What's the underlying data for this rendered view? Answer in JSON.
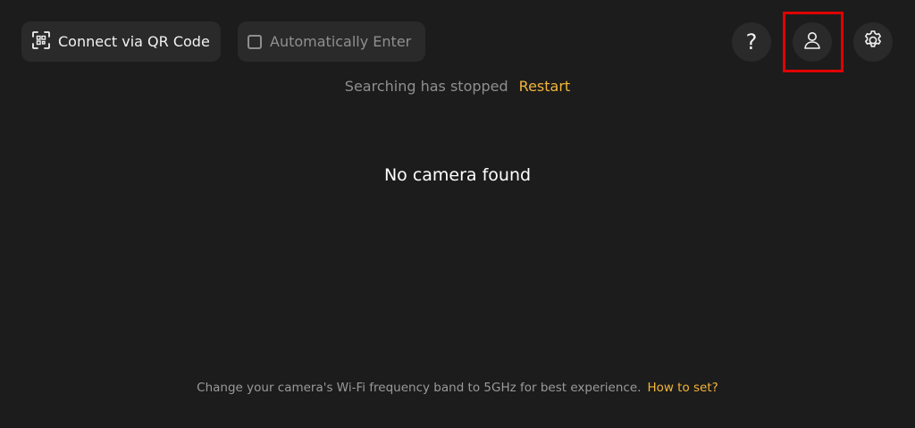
{
  "top_bar": {
    "qr_button_label": "Connect via QR Code",
    "auto_enter_label": "Automatically Enter",
    "auto_enter_checked": false,
    "help_glyph": "?",
    "icons": {
      "qr": "qr-scan-icon",
      "help": "question-mark-icon",
      "account": "user-icon",
      "settings": "gear-icon"
    }
  },
  "status": {
    "text": "Searching has stopped",
    "restart_label": "Restart"
  },
  "empty_state": {
    "message": "No camera found"
  },
  "footer": {
    "tip_text": "Change your camera's Wi-Fi frequency band to 5GHz for best experience.",
    "how_to_label": "How to set?"
  },
  "colors": {
    "background": "#1c1c1c",
    "button_bg": "#2a2a2a",
    "accent": "#f2b53a",
    "highlight": "#e00000"
  }
}
